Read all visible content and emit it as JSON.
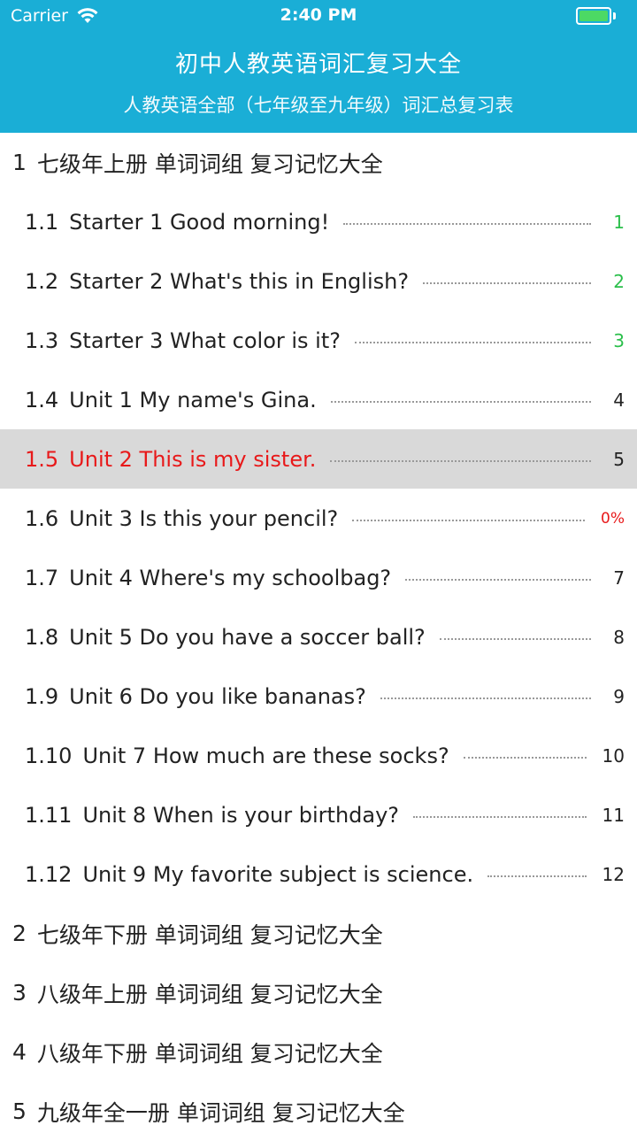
{
  "status_bar": {
    "carrier": "Carrier",
    "time": "2:40 PM"
  },
  "header": {
    "title": "初中人教英语词汇复习大全",
    "subtitle": "人教英语全部（七年级至九年级）词汇总复习表"
  },
  "sections": [
    {
      "num": "1",
      "label": "七级年上册  单词词组  复习记忆大全"
    },
    {
      "num": "2",
      "label": "七级年下册  单词词组  复习记忆大全"
    },
    {
      "num": "3",
      "label": "八级年上册  单词词组  复习记忆大全"
    },
    {
      "num": "4",
      "label": "八级年下册  单词词组  复习记忆大全"
    },
    {
      "num": "5",
      "label": "九级年全一册  单词词组  复习记忆大全"
    }
  ],
  "lessons": [
    {
      "num": "1.1",
      "title": "Starter 1 Good morning!",
      "page": "1",
      "state": "done"
    },
    {
      "num": "1.2",
      "title": "Starter 2 What's this in English?",
      "page": "2",
      "state": "done"
    },
    {
      "num": "1.3",
      "title": "Starter 3 What color is it?",
      "page": "3",
      "state": "done"
    },
    {
      "num": "1.4",
      "title": "Unit 1 My name's Gina.",
      "page": "4",
      "state": "normal"
    },
    {
      "num": "1.5",
      "title": "Unit 2 This is my sister.",
      "page": "5",
      "state": "selected"
    },
    {
      "num": "1.6",
      "title": "Unit 3 Is this your pencil?",
      "page": "0%",
      "state": "progress"
    },
    {
      "num": "1.7",
      "title": "Unit 4 Where's my schoolbag?",
      "page": "7",
      "state": "normal"
    },
    {
      "num": "1.8",
      "title": "Unit 5 Do you have a soccer ball?",
      "page": "8",
      "state": "normal"
    },
    {
      "num": "1.9",
      "title": "Unit 6 Do you like bananas?",
      "page": "9",
      "state": "normal"
    },
    {
      "num": "1.10",
      "title": "Unit 7 How much are these socks?",
      "page": "10",
      "state": "normal"
    },
    {
      "num": "1.11",
      "title": "Unit 8 When is your birthday?",
      "page": "11",
      "state": "normal"
    },
    {
      "num": "1.12",
      "title": "Unit 9 My favorite subject is science.",
      "page": "12",
      "state": "normal"
    }
  ],
  "colors": {
    "header_bg": "#1aaed6",
    "selected_text": "#e8191a",
    "selected_bg": "#d9d9d9",
    "done_page": "#2bbf4b"
  }
}
